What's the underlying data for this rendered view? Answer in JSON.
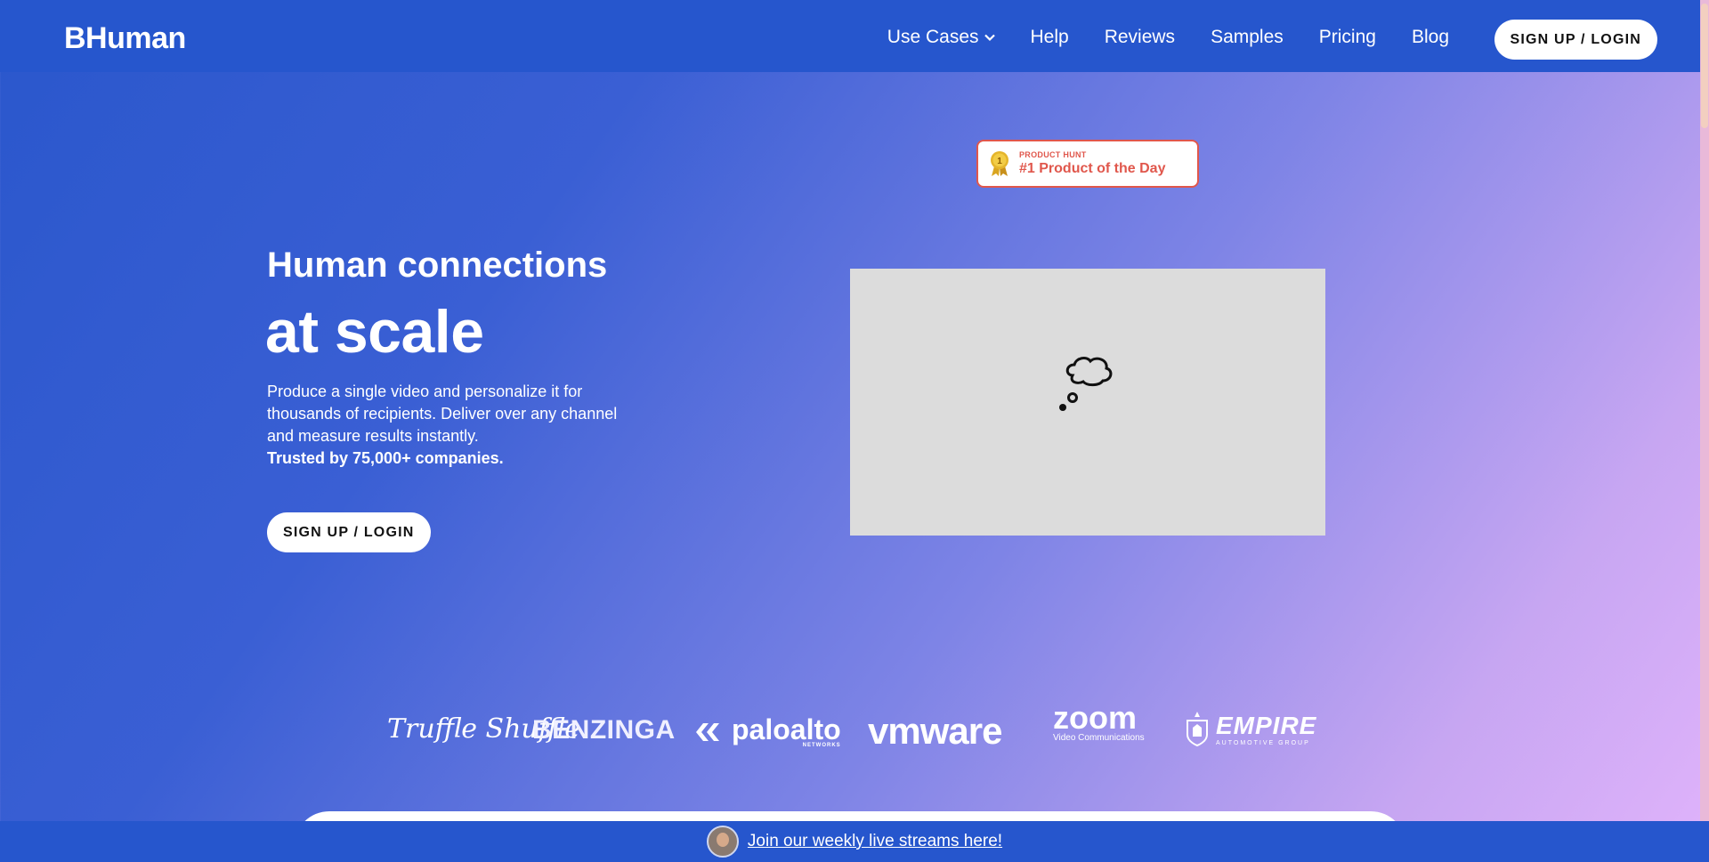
{
  "nav": {
    "logo": "BHuman",
    "links": [
      "Use Cases",
      "Help",
      "Reviews",
      "Samples",
      "Pricing",
      "Blog"
    ],
    "cta": "SIGN UP / LOGIN"
  },
  "badge": {
    "small": "PRODUCT HUNT",
    "big": "#1 Product of the Day",
    "medal_number": "1"
  },
  "hero": {
    "subtitle": "Human connections",
    "title": "at scale",
    "description": "Produce a single video and personalize it for thousands of recipients. Deliver over any channel and measure results instantly.",
    "trusted": "Trusted by 75,000+ companies.",
    "cta": "SIGN UP / LOGIN"
  },
  "logos": {
    "truffle": "Truffle Shuffle",
    "benzinga": "BENZINGA",
    "paloalto": "paloalto",
    "paloalto_sub": "NETWORKS",
    "vmware": "vmware",
    "zoom": "zoom",
    "zoom_sub": "Video Communications",
    "empire": "EMPIRE",
    "empire_sub": "AUTOMOTIVE GROUP"
  },
  "bottom_bar": {
    "link": "Join our weekly live streams here!"
  }
}
